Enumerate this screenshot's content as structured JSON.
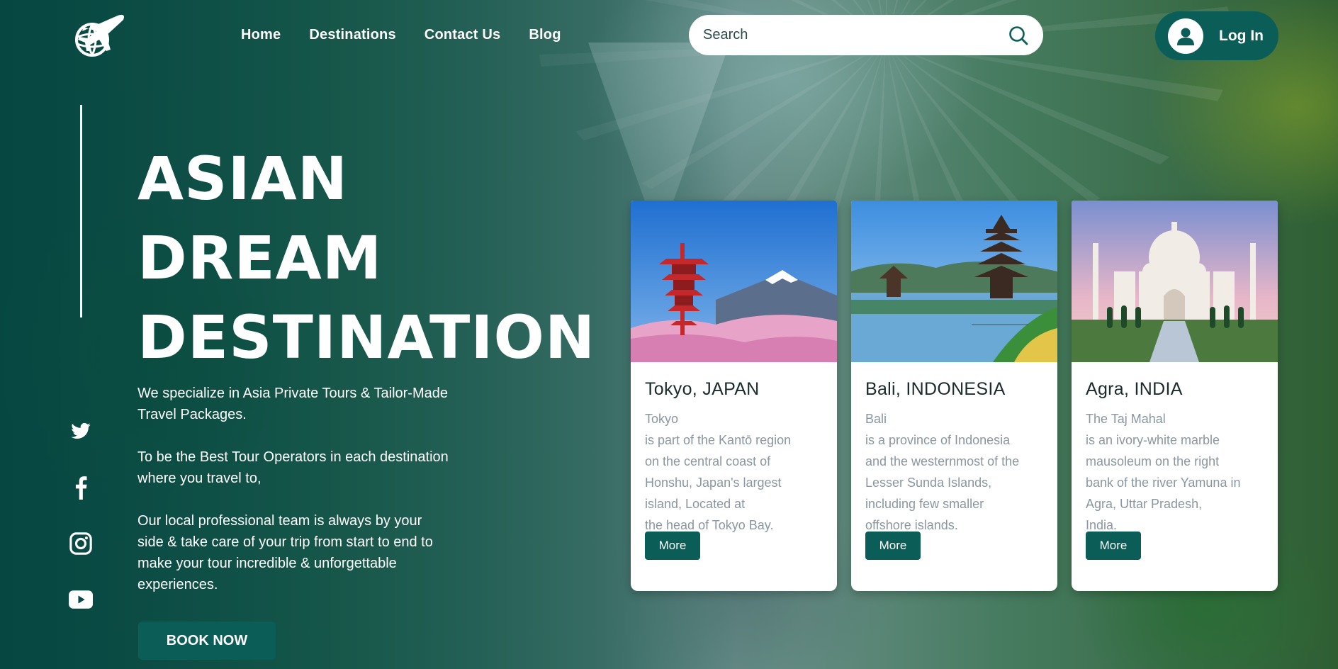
{
  "header": {
    "nav": [
      "Home",
      "Destinations",
      "Contact Us",
      "Blog"
    ],
    "search_placeholder": "Search",
    "login_label": "Log In"
  },
  "hero": {
    "title_lines": [
      "ASIAN",
      "DREAM",
      "DESTINATION"
    ],
    "paragraphs": [
      "We specialize in Asia Private Tours & Tailor-Made Travel Packages.",
      "To be the Best Tour Operators in each destination where you travel to,",
      "Our local professional team is always by your side & take care of your trip from start to end to make your tour incredible & unforgettable experiences."
    ],
    "book_label": "BOOK NOW"
  },
  "socials": [
    "twitter-icon",
    "facebook-icon",
    "instagram-icon",
    "youtube-icon"
  ],
  "cards": [
    {
      "title": "Tokyo, JAPAN",
      "lines": [
        "Tokyo",
        "is part of the Kantō region",
        "on the central coast of",
        "Honshu, Japan's largest",
        "island, Located at",
        "the head of Tokyo Bay."
      ],
      "more": "More"
    },
    {
      "title": "Bali, INDONESIA",
      "lines": [
        "Bali",
        "is a province of Indonesia",
        "and the westernmost of the",
        "Lesser Sunda Islands,",
        "including few smaller",
        "offshore islands."
      ],
      "more": "More"
    },
    {
      "title": "Agra, INDIA",
      "lines": [
        "The Taj Mahal",
        "is an ivory-white marble",
        "mausoleum on the right",
        "bank of the river Yamuna in",
        "Agra, Uttar Pradesh,",
        "India."
      ],
      "more": "More"
    }
  ],
  "colors": {
    "accent": "#0b5e58",
    "card_text": "#8a96a0"
  }
}
